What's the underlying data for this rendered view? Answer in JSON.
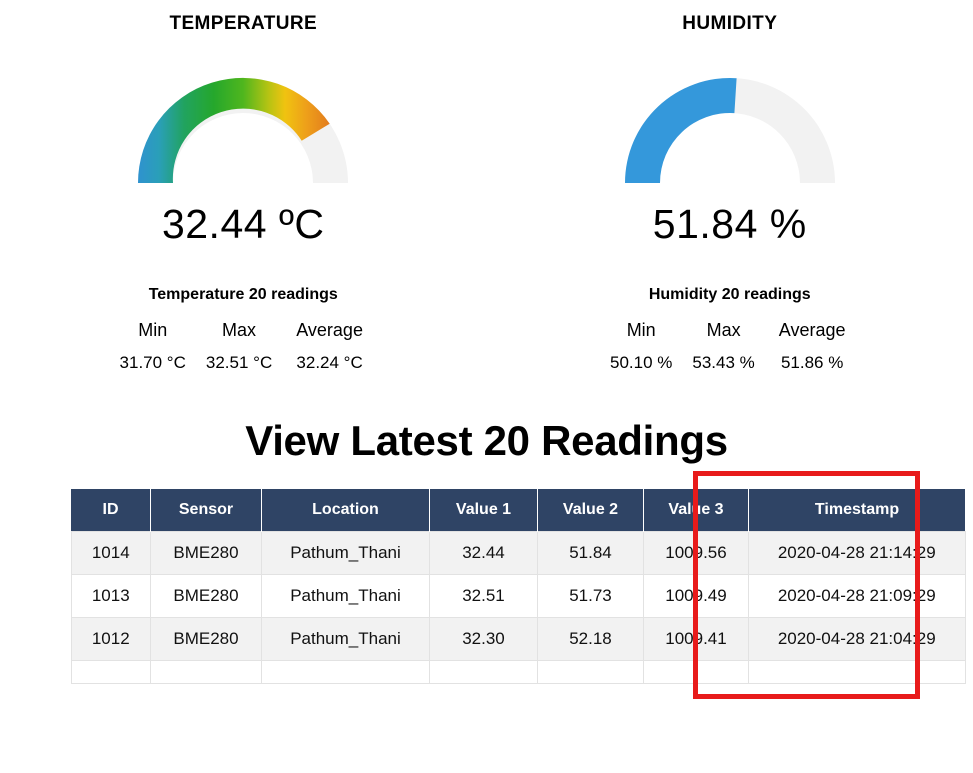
{
  "temperature": {
    "title": "TEMPERATURE",
    "value_text": "32.44 ºC",
    "gauge": {
      "value": 32.44,
      "percent": 81,
      "track_color": "#f2f2f2"
    },
    "stats_caption": "Temperature 20 readings",
    "stats_headers": [
      "Min",
      "Max",
      "Average"
    ],
    "stats_values": [
      "31.70 °C",
      "32.51 °C",
      "32.24 °C"
    ]
  },
  "humidity": {
    "title": "HUMIDITY",
    "value_text": "51.84 %",
    "gauge": {
      "value": 51.84,
      "percent": 52,
      "fill_color": "#3498db",
      "track_color": "#f2f2f2"
    },
    "stats_caption": "Humidity 20 readings",
    "stats_headers": [
      "Min",
      "Max",
      "Average"
    ],
    "stats_values": [
      "50.10 %",
      "53.43 %",
      "51.86 %"
    ]
  },
  "readings": {
    "heading": "View Latest 20 Readings",
    "columns": [
      "ID",
      "Sensor",
      "Location",
      "Value 1",
      "Value 2",
      "Value 3",
      "Timestamp"
    ],
    "rows": [
      {
        "id": "1014",
        "sensor": "BME280",
        "location": "Pathum_Thani",
        "value1": "32.44",
        "value2": "51.84",
        "value3": "1009.56",
        "timestamp": "2020-04-28 21:14:29"
      },
      {
        "id": "1013",
        "sensor": "BME280",
        "location": "Pathum_Thani",
        "value1": "32.51",
        "value2": "51.73",
        "value3": "1009.49",
        "timestamp": "2020-04-28 21:09:29"
      },
      {
        "id": "1012",
        "sensor": "BME280",
        "location": "Pathum_Thani",
        "value1": "32.30",
        "value2": "52.18",
        "value3": "1009.41",
        "timestamp": "2020-04-28 21:04:29"
      },
      {
        "id": "",
        "sensor": "",
        "location": "",
        "value1": "",
        "value2": "",
        "value3": "",
        "timestamp": ""
      }
    ],
    "header_color": "#2f4465",
    "stripe_color": "#f2f2f2"
  },
  "annotation": {
    "color": "#e81b1b",
    "target": "Timestamp column highlight"
  }
}
